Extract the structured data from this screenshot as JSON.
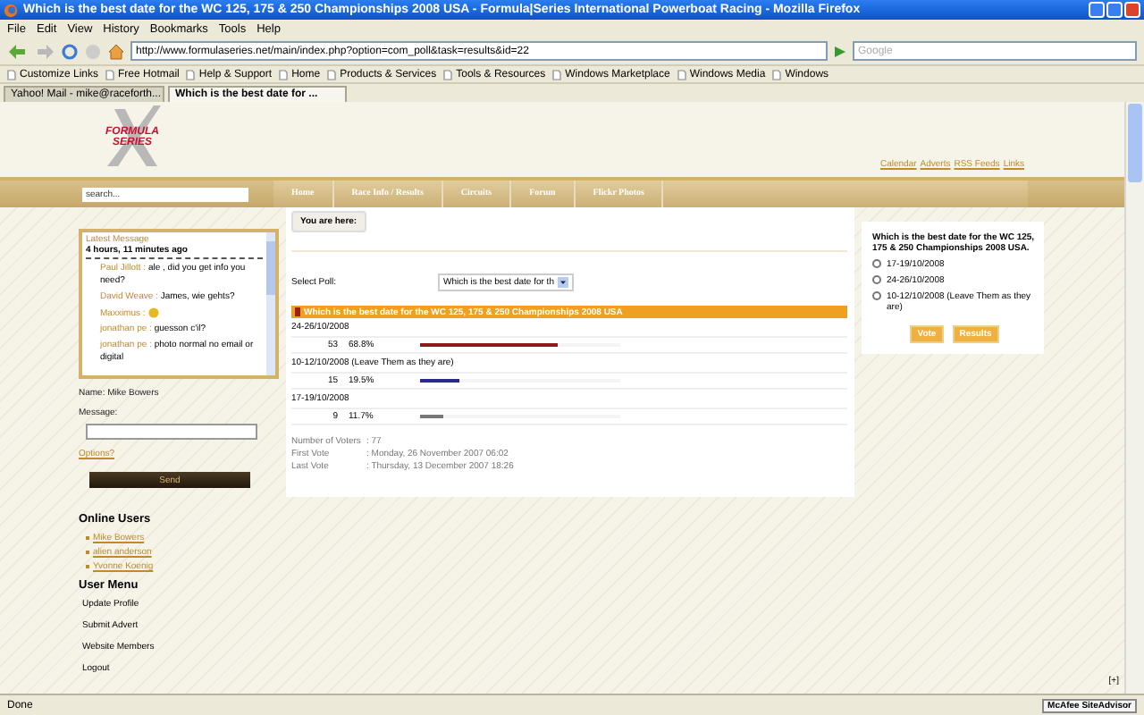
{
  "window": {
    "title": "Which is the best date for the WC 125, 175 & 250 Championships 2008 USA - Formula|Series International Powerboat Racing - Mozilla Firefox"
  },
  "menu": [
    "File",
    "Edit",
    "View",
    "History",
    "Bookmarks",
    "Tools",
    "Help"
  ],
  "address": "http://www.formulaseries.net/main/index.php?option=com_poll&task=results&id=22",
  "web_search": {
    "placeholder": "Google"
  },
  "bookmarks": [
    "Customize Links",
    "Free Hotmail",
    "Help & Support",
    "Home",
    "Products & Services",
    "Tools & Resources",
    "Windows Marketplace",
    "Windows Media",
    "Windows"
  ],
  "tabs": [
    {
      "label": "Yahoo! Mail - mike@raceforth...",
      "selected": false
    },
    {
      "label": "Which is the best date for ...",
      "selected": true
    }
  ],
  "site": {
    "logo": [
      "FORMULA",
      "SERIES"
    ],
    "header_links": [
      "Calendar",
      "Adverts",
      "RSS Feeds",
      "Links"
    ],
    "search": {
      "placeholder": "search..."
    },
    "nav": [
      "Home",
      "Race Info / Results",
      "Circuits",
      "Forum",
      "Flickr Photos"
    ]
  },
  "chat": {
    "title": "Latest Message",
    "time": "4 hours, 11 minutes ago",
    "messages": [
      {
        "name": "Paul Jillott :",
        "text": "ale , did you get info you need?",
        "emoticon": false
      },
      {
        "name": "David Weave :",
        "text": "James, wie gehts?",
        "emoticon": false
      },
      {
        "name": "Maxximus :",
        "emoticon": true
      },
      {
        "name": "jonathan pe :",
        "text": "guesson c'il?",
        "emoticon": false
      },
      {
        "name": "jonathan pe :",
        "text": "photo normal no email or digital",
        "emoticon": false
      }
    ],
    "name_line": "Name: Mike Bowers",
    "message_label": "Message:",
    "options_link": "Options?",
    "send": "Send"
  },
  "online_users": {
    "title": "Online Users",
    "users": [
      "Mike Bowers",
      "alien anderson",
      "Yvonne Koenig"
    ]
  },
  "user_menu": {
    "title": "User Menu",
    "items": [
      "Update Profile",
      "Submit Advert",
      "Website Members",
      "Logout"
    ]
  },
  "breadcrumb": "You are here:",
  "poll_select": {
    "label": "Select Poll:",
    "value": "Which is the best date for th"
  },
  "results": {
    "title": "Which is the best date for the WC 125, 175 & 250 Championships 2008 USA",
    "options": [
      {
        "label": "24-26/10/2008",
        "votes": "53",
        "percent": "68.8%",
        "level": 0.688,
        "color": "#8b1a1a"
      },
      {
        "label": "10-12/10/2008 (Leave Them as they are)",
        "votes": "15",
        "percent": "19.5%",
        "level": 0.195,
        "color": "#2a2a8a"
      },
      {
        "label": "17-19/10/2008",
        "votes": "9",
        "percent": "11.7%",
        "level": 0.117,
        "color": "#777777"
      }
    ],
    "stats": [
      {
        "label": "Number of Voters",
        "value": ": 77"
      },
      {
        "label": "First Vote",
        "value": ": Monday, 26 November 2007 06:02"
      },
      {
        "label": "Last Vote",
        "value": ": Thursday, 13 December 2007 18:26"
      }
    ]
  },
  "side_poll": {
    "question": "Which is the best date for the WC 125, 175 & 250 Championships 2008 USA.",
    "options": [
      {
        "label": "17-19/10/2008",
        "selected": false
      },
      {
        "label": "24-26/10/2008",
        "selected": false
      },
      {
        "label": "10-12/10/2008 (Leave Them as they are)",
        "selected": false
      }
    ],
    "buttons": [
      "Vote",
      "Results"
    ]
  },
  "page_corner": "[+]",
  "status_bar": {
    "text": "Done",
    "addon": "McAfee SiteAdvisor"
  }
}
